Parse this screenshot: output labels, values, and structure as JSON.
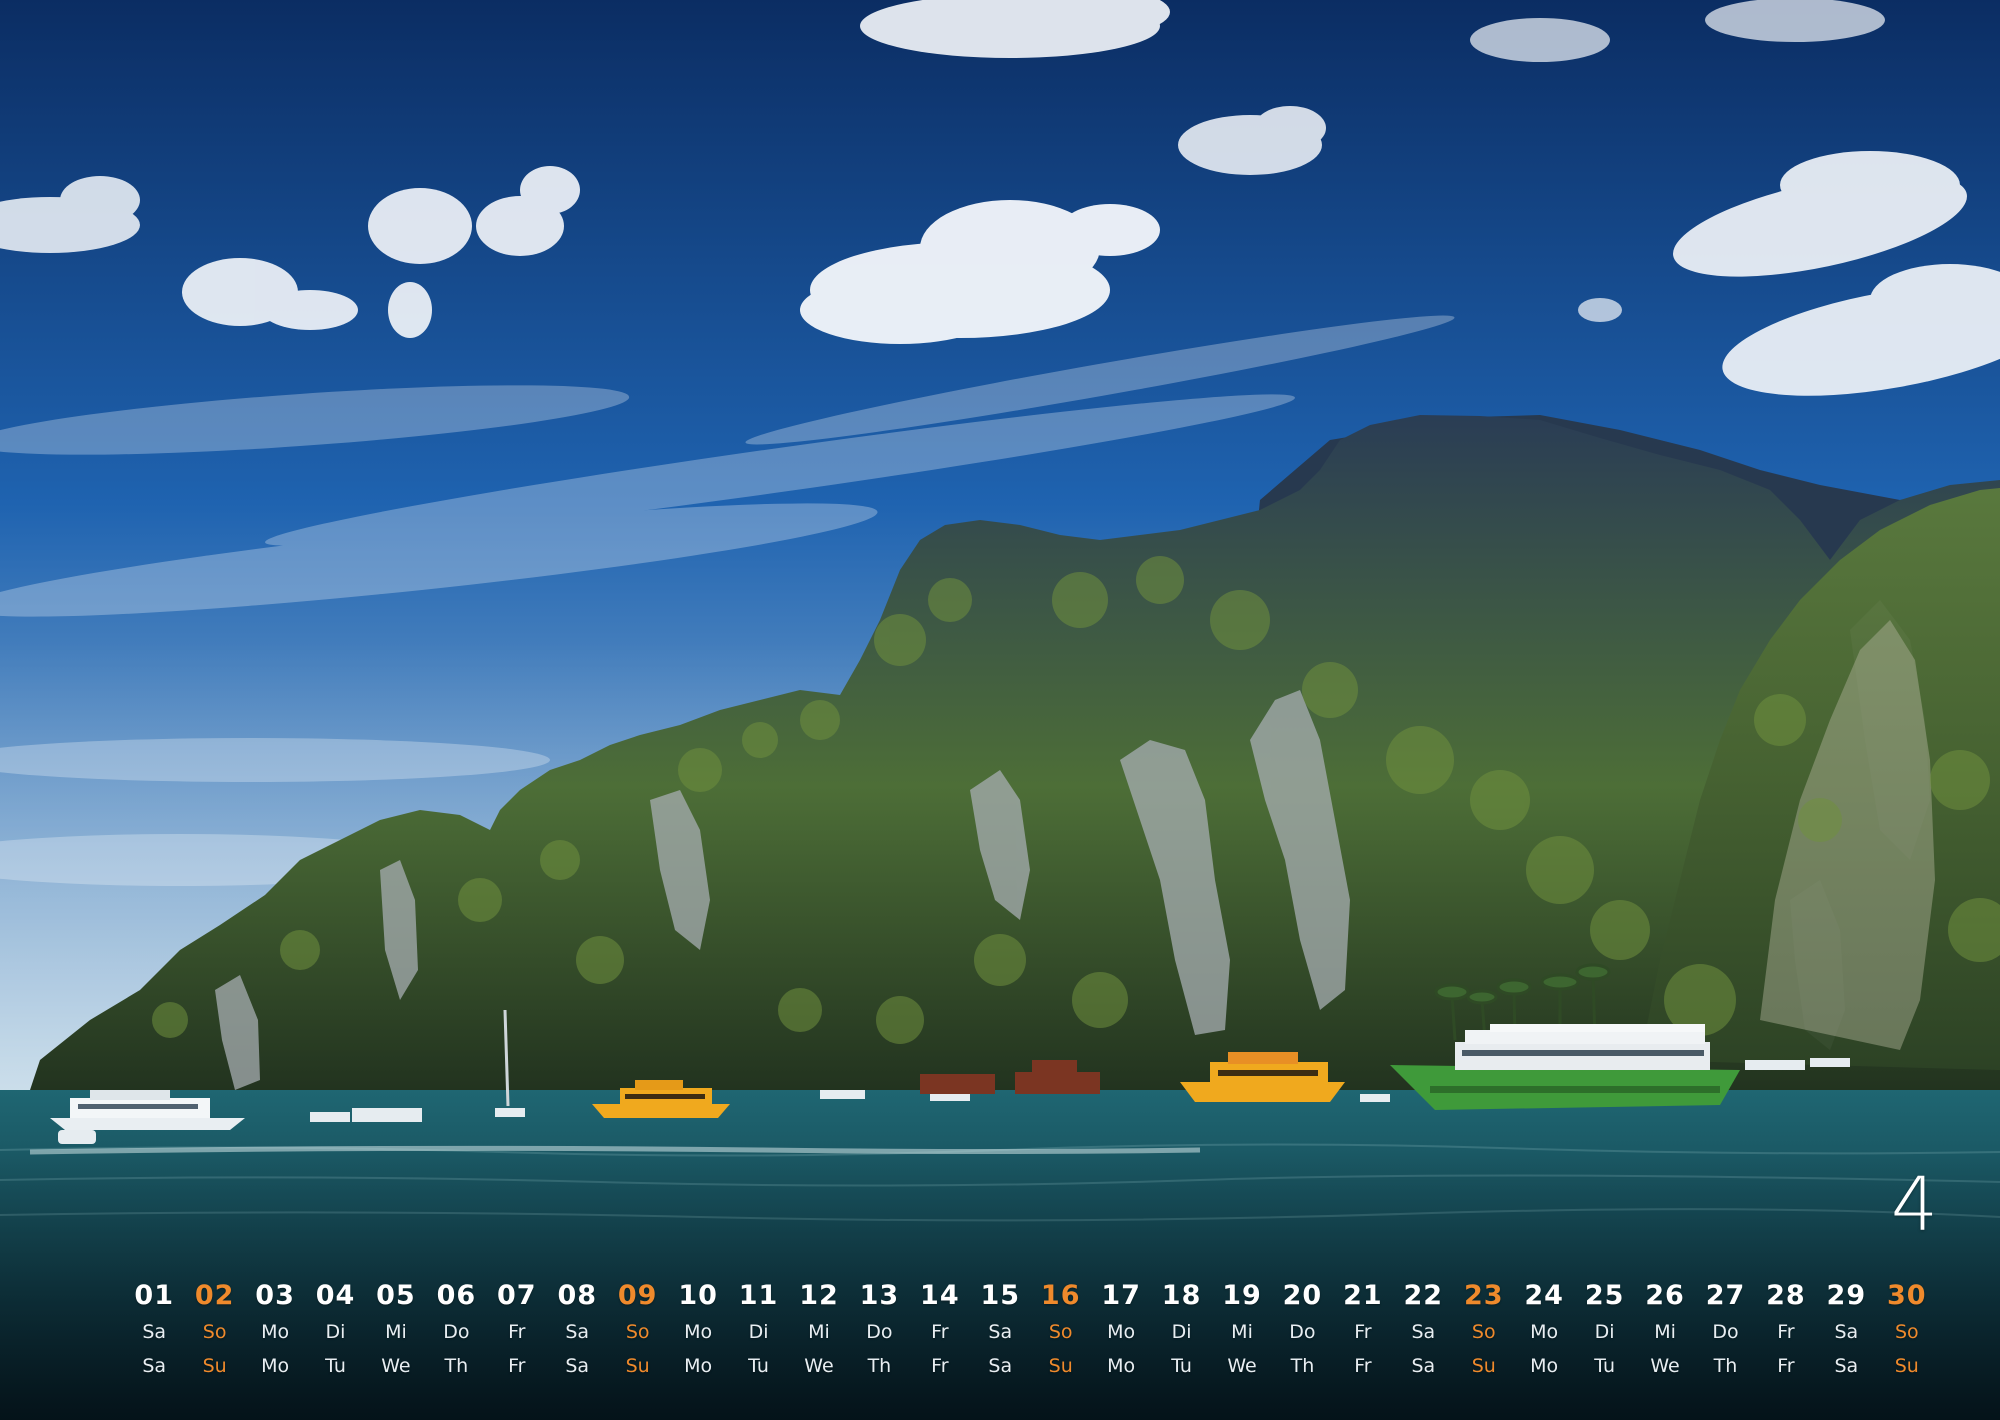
{
  "calendar": {
    "month_number": "4",
    "highlight_color": "#ef8a2c",
    "text_color": "#ffffff",
    "days": [
      {
        "date": "01",
        "de": "Sa",
        "en": "Sa",
        "sunday": false
      },
      {
        "date": "02",
        "de": "So",
        "en": "Su",
        "sunday": true
      },
      {
        "date": "03",
        "de": "Mo",
        "en": "Mo",
        "sunday": false
      },
      {
        "date": "04",
        "de": "Di",
        "en": "Tu",
        "sunday": false
      },
      {
        "date": "05",
        "de": "Mi",
        "en": "We",
        "sunday": false
      },
      {
        "date": "06",
        "de": "Do",
        "en": "Th",
        "sunday": false
      },
      {
        "date": "07",
        "de": "Fr",
        "en": "Fr",
        "sunday": false
      },
      {
        "date": "08",
        "de": "Sa",
        "en": "Sa",
        "sunday": false
      },
      {
        "date": "09",
        "de": "So",
        "en": "Su",
        "sunday": true
      },
      {
        "date": "10",
        "de": "Mo",
        "en": "Mo",
        "sunday": false
      },
      {
        "date": "11",
        "de": "Di",
        "en": "Tu",
        "sunday": false
      },
      {
        "date": "12",
        "de": "Mi",
        "en": "We",
        "sunday": false
      },
      {
        "date": "13",
        "de": "Do",
        "en": "Th",
        "sunday": false
      },
      {
        "date": "14",
        "de": "Fr",
        "en": "Fr",
        "sunday": false
      },
      {
        "date": "15",
        "de": "Sa",
        "en": "Sa",
        "sunday": false
      },
      {
        "date": "16",
        "de": "So",
        "en": "Su",
        "sunday": true
      },
      {
        "date": "17",
        "de": "Mo",
        "en": "Mo",
        "sunday": false
      },
      {
        "date": "18",
        "de": "Di",
        "en": "Tu",
        "sunday": false
      },
      {
        "date": "19",
        "de": "Mi",
        "en": "We",
        "sunday": false
      },
      {
        "date": "20",
        "de": "Do",
        "en": "Th",
        "sunday": false
      },
      {
        "date": "21",
        "de": "Fr",
        "en": "Fr",
        "sunday": false
      },
      {
        "date": "22",
        "de": "Sa",
        "en": "Sa",
        "sunday": false
      },
      {
        "date": "23",
        "de": "So",
        "en": "Su",
        "sunday": true
      },
      {
        "date": "24",
        "de": "Mo",
        "en": "Mo",
        "sunday": false
      },
      {
        "date": "25",
        "de": "Di",
        "en": "Tu",
        "sunday": false
      },
      {
        "date": "26",
        "de": "Mi",
        "en": "We",
        "sunday": false
      },
      {
        "date": "27",
        "de": "Do",
        "en": "Th",
        "sunday": false
      },
      {
        "date": "28",
        "de": "Fr",
        "en": "Fr",
        "sunday": false
      },
      {
        "date": "29",
        "de": "Sa",
        "en": "Sa",
        "sunday": false
      },
      {
        "date": "30",
        "de": "So",
        "en": "Su",
        "sunday": true
      }
    ]
  },
  "photo": {
    "colors": {
      "sky_top": "#0b2d63",
      "sky_mid": "#1f63b0",
      "sky_horizon": "#b9d3e3",
      "cliff_dark": "#25384e",
      "cliff_green": "#4d6e37",
      "rock_light": "#a7aeb2",
      "sea_top": "#1f6672",
      "sea_bottom": "#08222e",
      "boat_yellow": "#f0a91e",
      "boat_green": "#3f9a3a"
    }
  }
}
